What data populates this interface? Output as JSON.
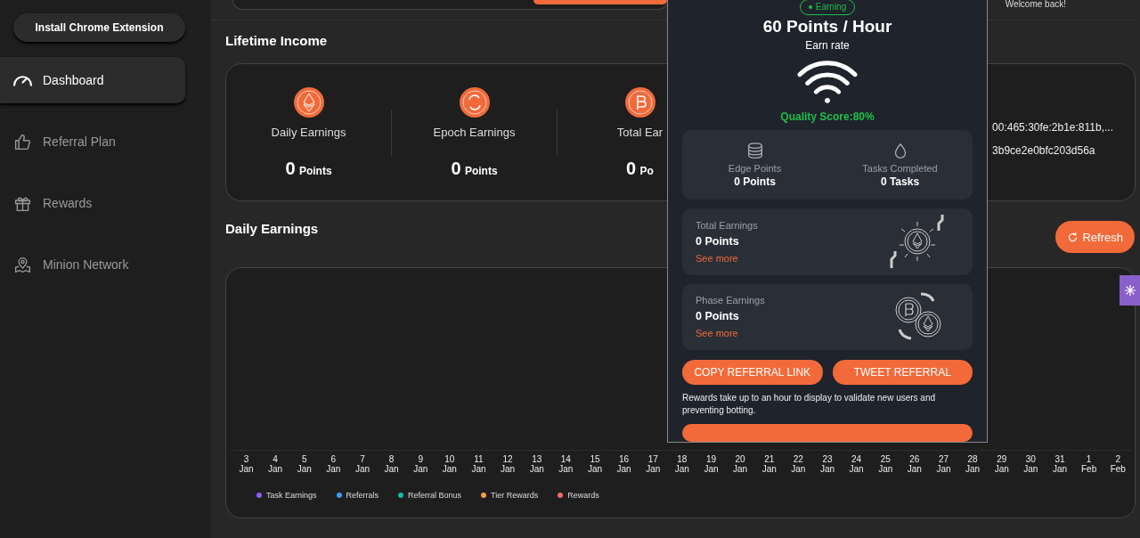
{
  "sidebar": {
    "install_button": "Install Chrome Extension",
    "items": [
      {
        "label": "Dashboard",
        "selected": true
      },
      {
        "label": "Referral Plan",
        "selected": false
      },
      {
        "label": "Rewards",
        "selected": false
      },
      {
        "label": "Minion Network",
        "selected": false
      }
    ]
  },
  "header": {
    "greeting": "Welcome back!"
  },
  "lifetime_income": {
    "title": "Lifetime Income",
    "stats": [
      {
        "label": "Daily Earnings",
        "value": "0",
        "unit": "Points"
      },
      {
        "label": "Epoch Earnings",
        "value": "0",
        "unit": "Points"
      },
      {
        "label": "Total Ear",
        "value": "0",
        "unit": "Po"
      }
    ],
    "address_lines": [
      "00:465:30fe:2b1e:811b,...",
      "3b9ce2e0bfc203d56a"
    ]
  },
  "daily_earnings": {
    "title": "Daily Earnings",
    "refresh_button": "Refresh",
    "axis_labels": [
      {
        "day": "3",
        "month": "Jan"
      },
      {
        "day": "4",
        "month": "Jan"
      },
      {
        "day": "5",
        "month": "Jan"
      },
      {
        "day": "6",
        "month": "Jan"
      },
      {
        "day": "7",
        "month": "Jan"
      },
      {
        "day": "8",
        "month": "Jan"
      },
      {
        "day": "9",
        "month": "Jan"
      },
      {
        "day": "10",
        "month": "Jan"
      },
      {
        "day": "11",
        "month": "Jan"
      },
      {
        "day": "12",
        "month": "Jan"
      },
      {
        "day": "13",
        "month": "Jan"
      },
      {
        "day": "14",
        "month": "Jan"
      },
      {
        "day": "15",
        "month": "Jan"
      },
      {
        "day": "16",
        "month": "Jan"
      },
      {
        "day": "17",
        "month": "Jan"
      },
      {
        "day": "18",
        "month": "Jan"
      },
      {
        "day": "19",
        "month": "Jan"
      },
      {
        "day": "20",
        "month": "Jan"
      },
      {
        "day": "21",
        "month": "Jan"
      },
      {
        "day": "22",
        "month": "Jan"
      },
      {
        "day": "23",
        "month": "Jan"
      },
      {
        "day": "24",
        "month": "Jan"
      },
      {
        "day": "25",
        "month": "Jan"
      },
      {
        "day": "26",
        "month": "Jan"
      },
      {
        "day": "27",
        "month": "Jan"
      },
      {
        "day": "28",
        "month": "Jan"
      },
      {
        "day": "29",
        "month": "Jan"
      },
      {
        "day": "30",
        "month": "Jan"
      },
      {
        "day": "31",
        "month": "Jan"
      },
      {
        "day": "1",
        "month": "Feb"
      },
      {
        "day": "2",
        "month": "Feb"
      }
    ],
    "legend": [
      {
        "label": "Task Earnings",
        "color": "#8b5cf6"
      },
      {
        "label": "Referrals",
        "color": "#3b9cf6"
      },
      {
        "label": "Referral Bonus",
        "color": "#14b8a6"
      },
      {
        "label": "Tier Rewards",
        "color": "#f5a03b"
      },
      {
        "label": "Rewards",
        "color": "#f26b6b"
      }
    ]
  },
  "popup": {
    "status": "Earning",
    "rate": "60 Points / Hour",
    "rate_label": "Earn rate",
    "quality": "Quality Score:80%",
    "stats": [
      {
        "label": "Edge Points",
        "value": "0 Points"
      },
      {
        "label": "Tasks Completed",
        "value": "0 Tasks"
      }
    ],
    "cards": [
      {
        "label": "Total Earnings",
        "value": "0 Points",
        "link": "See more"
      },
      {
        "label": "Phase Earnings",
        "value": "0 Points",
        "link": "See more"
      }
    ],
    "buttons": [
      "COPY REFERRAL LINK",
      "TWEET REFERRAL"
    ],
    "note": "Rewards take up to an hour to display to validate new users and preventing botting."
  }
}
